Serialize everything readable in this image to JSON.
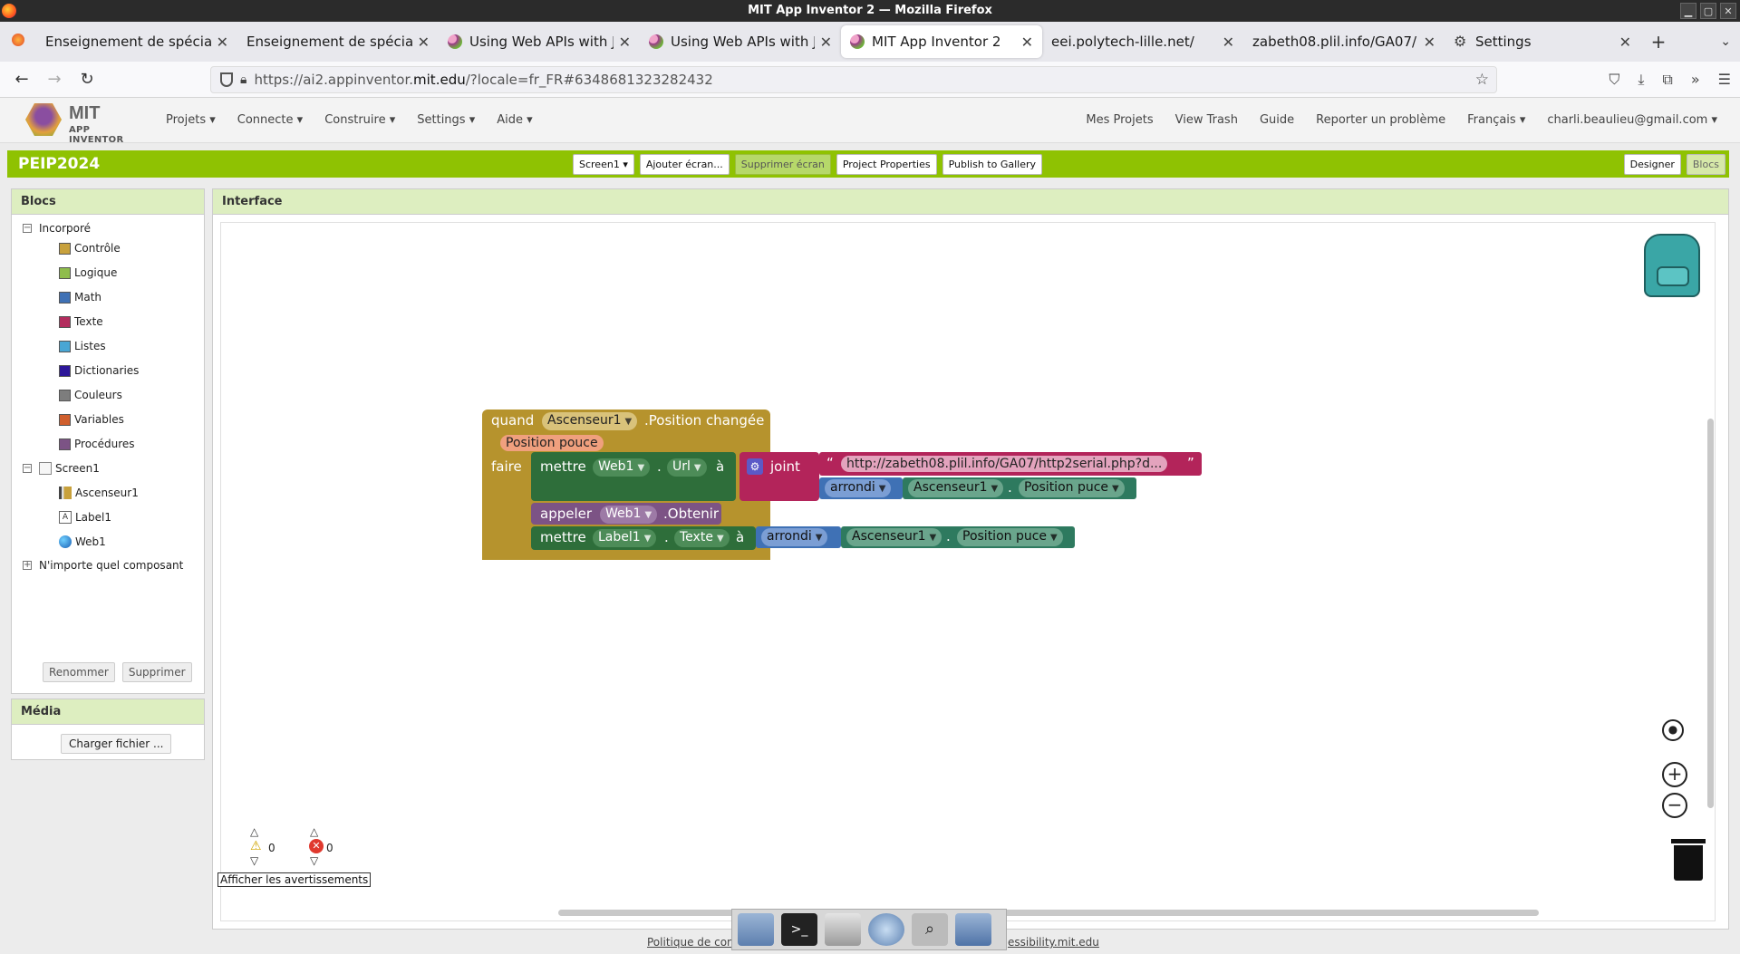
{
  "window": {
    "title": "MIT App Inventor 2 — Mozilla Firefox"
  },
  "tabs": [
    {
      "label": "Enseignement de spécialité"
    },
    {
      "label": "Enseignement de spécialité"
    },
    {
      "label": "Using Web APIs with JSO"
    },
    {
      "label": "Using Web APIs with JSO"
    },
    {
      "label": "MIT App Inventor 2"
    },
    {
      "label": "eei.polytech-lille.net/"
    },
    {
      "label": "zabeth08.plil.info/GA07/"
    },
    {
      "label": "Settings"
    }
  ],
  "address_bar": {
    "url_prefix": "https://ai2.appinventor.",
    "url_domain": "mit.edu",
    "url_suffix": "/?locale=fr_FR#6348681323282432"
  },
  "app": {
    "logo_text": "MIT",
    "logo_sub": "APP INVENTOR",
    "menu": [
      "Projets ▾",
      "Connecte ▾",
      "Construire ▾",
      "Settings ▾",
      "Aide ▾"
    ],
    "right_menu": [
      "Mes Projets",
      "View Trash",
      "Guide",
      "Reporter un problème",
      "Français ▾",
      "charli.beaulieu@gmail.com ▾"
    ]
  },
  "project": {
    "name": "PEIP2024",
    "screen_select": "Screen1 ▾",
    "add_screen": "Ajouter écran...",
    "remove_screen": "Supprimer écran",
    "properties": "Project Properties",
    "publish": "Publish to Gallery",
    "designer": "Designer",
    "blocks": "Blocs"
  },
  "blocs_panel": {
    "title": "Blocs",
    "builtin": "Incorporé",
    "categories": [
      {
        "label": "Contrôle",
        "color": "#c8a13c"
      },
      {
        "label": "Logique",
        "color": "#8fbd4c"
      },
      {
        "label": "Math",
        "color": "#3f71b5"
      },
      {
        "label": "Texte",
        "color": "#b32d5e"
      },
      {
        "label": "Listes",
        "color": "#49a6d4"
      },
      {
        "label": "Dictionaries",
        "color": "#2d1799"
      },
      {
        "label": "Couleurs",
        "color": "#7d7d7d"
      },
      {
        "label": "Variables",
        "color": "#d05f2d"
      },
      {
        "label": "Procédures",
        "color": "#7c5385"
      }
    ],
    "screen": "Screen1",
    "components": [
      "Ascenseur1",
      "Label1",
      "Web1"
    ],
    "any_component": "N'importe quel composant",
    "rename": "Renommer",
    "delete": "Supprimer"
  },
  "media_panel": {
    "title": "Média",
    "upload": "Charger fichier ..."
  },
  "interface": {
    "title": "Interface",
    "event": {
      "when": "quand",
      "component": "Ascenseur1",
      "event_name": ".Position changée",
      "param": "Position pouce",
      "do": "faire"
    },
    "stmt1": {
      "set": "mettre",
      "component": "Web1",
      "dot": ".",
      "prop": "Url",
      "to": "à",
      "join": "joint",
      "string": "http://zabeth08.plil.info/GA07/http2serial.php?d...",
      "round": "arrondi",
      "comp2": "Ascenseur1",
      "prop2": "Position puce"
    },
    "stmt2": {
      "call": "appeler",
      "component": "Web1",
      "method": ".Obtenir"
    },
    "stmt3": {
      "set": "mettre",
      "component": "Label1",
      "dot": ".",
      "prop": "Texte",
      "to": "à",
      "round": "arrondi",
      "comp2": "Ascenseur1",
      "prop2": "Position puce"
    },
    "warnings_count": "0",
    "errors_count": "0",
    "show_warnings": "Afficher les avertissements"
  },
  "footer": {
    "left": "Politique de confi",
    "right": "essibility.mit.edu"
  }
}
